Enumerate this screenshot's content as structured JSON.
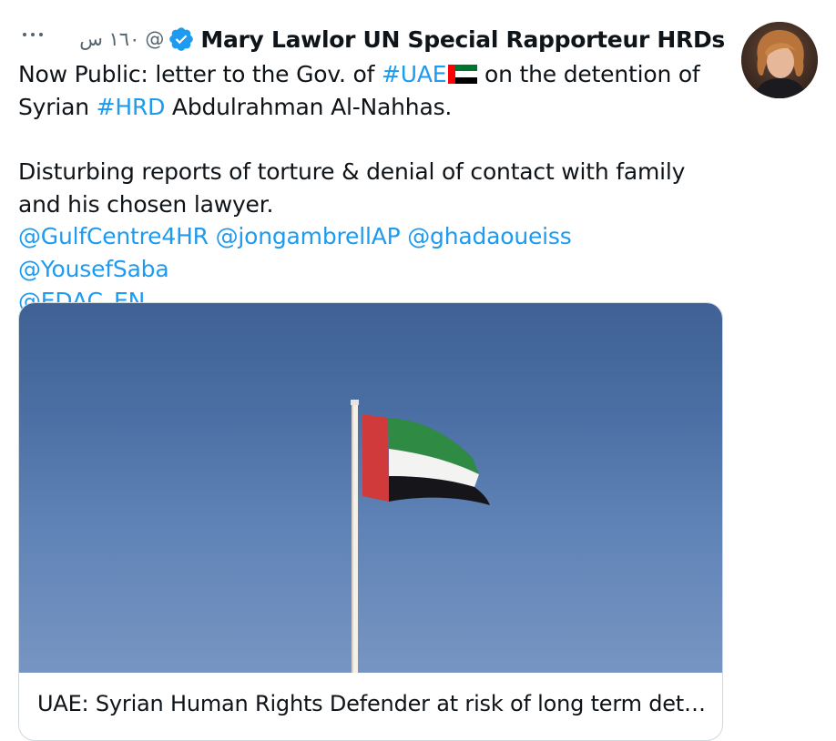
{
  "tweet": {
    "author_name": "Mary Lawlor UN Special Rapporteur HRDs",
    "handle_at": "@",
    "time": "١٦٠ س",
    "more_label": "More",
    "text": {
      "line1_prefix": "Now Public: letter to the Gov. of ",
      "hashtag_uae": "#UAE",
      "line1_suffix": " on the detention of",
      "line2_prefix": "Syrian ",
      "hashtag_hrd": "#HRD",
      "line2_suffix": " Abdulrahman Al-Nahhas.",
      "para2": "Disturbing reports of torture & denial of contact with family and his chosen lawyer.",
      "mentions": [
        "@GulfCentre4HR",
        "@jongambrellAP",
        "@ghadaoueiss",
        "@YousefSaba",
        "@EDAC_EN"
      ]
    },
    "card": {
      "title": "UAE: Syrian Human Rights Defender at risk of long term det…"
    }
  },
  "icons": {
    "verified": "verified-badge-icon",
    "flag": "uae-flag-emoji-icon",
    "more": "more-dots-icon"
  },
  "colors": {
    "link": "#1d9bf0",
    "text": "#0f1419",
    "secondary": "#536471",
    "border": "#cfd9de"
  }
}
